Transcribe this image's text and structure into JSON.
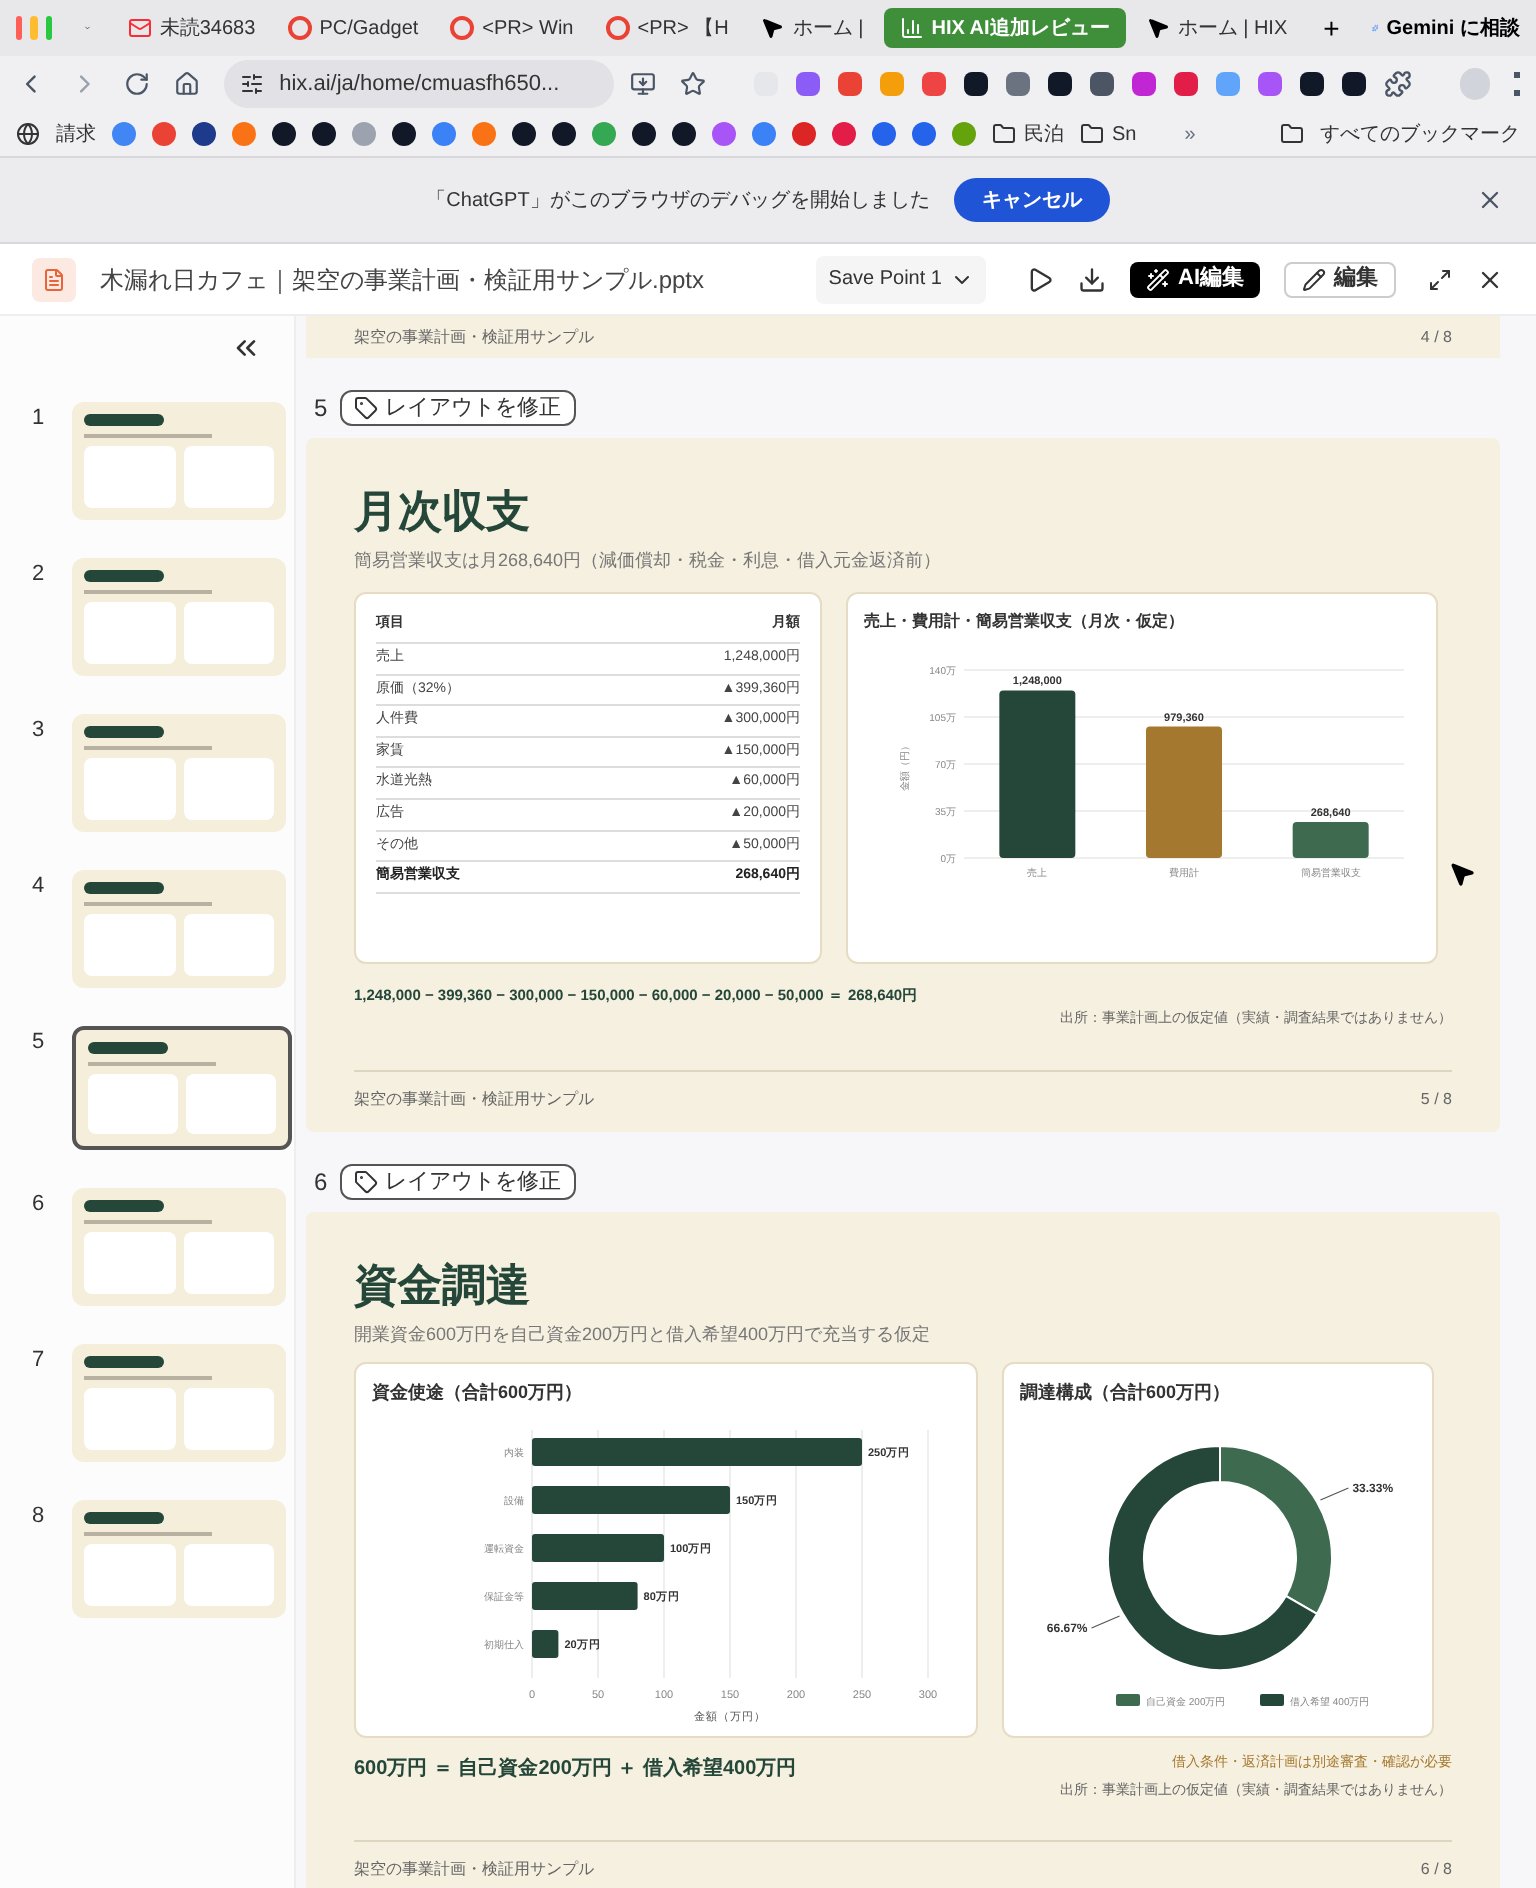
{
  "browser": {
    "tabs": [
      {
        "label": "未読34683",
        "selected": false
      },
      {
        "label": "PC/Gadget",
        "selected": false
      },
      {
        "label": "<PR> Win",
        "selected": false
      },
      {
        "label": "<PR> 【H",
        "selected": false
      },
      {
        "label": "ホーム |",
        "selected": false
      },
      {
        "label": "HIX AI追加レビュー",
        "selected": true
      },
      {
        "label": "ホーム | HIX",
        "selected": false
      }
    ],
    "new_tab": "+",
    "gemini": "Gemini に相談",
    "address": "hix.ai/ja/home/cmuasfh650...",
    "bookmark_first": "請求",
    "folders": [
      "民泊",
      "Sn"
    ],
    "more": "»",
    "all_bookmarks": "すべてのブックマーク"
  },
  "infobar": {
    "message": "「ChatGPT」がこのブラウザのデバッグを開始しました",
    "button": "キャンセル"
  },
  "header": {
    "file_name": "木漏れ日カフェ｜架空の事業計画・検証用サンプル.pptx",
    "save_point": "Save Point 1",
    "ai_edit": "AI編集",
    "edit": "編集"
  },
  "sidebar": {
    "slides": [
      {
        "number": "1",
        "selected": false
      },
      {
        "number": "2",
        "selected": false
      },
      {
        "number": "3",
        "selected": false
      },
      {
        "number": "4",
        "selected": false
      },
      {
        "number": "5",
        "selected": true
      },
      {
        "number": "6",
        "selected": false
      },
      {
        "number": "7",
        "selected": false
      },
      {
        "number": "8",
        "selected": false
      }
    ]
  },
  "slides": [
    {
      "kind": "partial",
      "footer": "架空の事業計画・検証用サンプル",
      "page": "4 / 8"
    },
    {
      "kind": "table_chart",
      "number": "5",
      "fix_button": "レイアウトを修正",
      "title": "月次収支",
      "subtitle": "簡易営業収支は月268,640円（減価償却・税金・利息・借入元金返済前）",
      "table": {
        "columns": [
          "項目",
          "月額"
        ],
        "rows": [
          {
            "item": "売上",
            "amount": "1,248,000円",
            "bold": false
          },
          {
            "item": "原価（32%）",
            "amount": "▲399,360円",
            "bold": false
          },
          {
            "item": "人件費",
            "amount": "▲300,000円",
            "bold": false
          },
          {
            "item": "家賃",
            "amount": "▲150,000円",
            "bold": false
          },
          {
            "item": "水道光熱",
            "amount": "▲60,000円",
            "bold": false
          },
          {
            "item": "広告",
            "amount": "▲20,000円",
            "bold": false
          },
          {
            "item": "その他",
            "amount": "▲50,000円",
            "bold": false
          },
          {
            "item": "簡易営業収支",
            "amount": "268,640円",
            "bold": true
          }
        ]
      },
      "chart_data": {
        "type": "bar",
        "title": "売上・費用計・簡易営業収支（月次・仮定）",
        "ylabel": "金額（円）",
        "categories": [
          "売上",
          "費用計",
          "簡易営業収支"
        ],
        "values": [
          124.8,
          97.9,
          26.9
        ],
        "colors": [
          "#24473a",
          "#a5782f",
          "#3e6b50"
        ],
        "grid": true,
        "ylim": [
          0,
          140
        ],
        "yticks": [
          {
            "value": 0,
            "label": "0万"
          },
          {
            "value": 35,
            "label": "35万"
          },
          {
            "value": 70,
            "label": "70万"
          },
          {
            "value": 105,
            "label": "105万"
          },
          {
            "value": 140,
            "label": "140万"
          }
        ],
        "annotations": [
          {
            "x": "売上",
            "y": 124.8,
            "text": "1,248,000"
          },
          {
            "x": "費用計",
            "y": 97.9,
            "text": "979,360"
          },
          {
            "x": "簡易営業収支",
            "y": 26.9,
            "text": "268,640"
          }
        ]
      },
      "formula": "1,248,000 − 399,360 − 300,000 − 150,000 − 60,000 − 20,000 − 50,000 ＝ 268,640円",
      "source": "出所：事業計画上の仮定値（実績・調査結果ではありません）",
      "footer": "架空の事業計画・検証用サンプル",
      "page": "5 / 8"
    },
    {
      "kind": "funding",
      "number": "6",
      "fix_button": "レイアウトを修正",
      "title": "資金調達",
      "subtitle": "開業資金600万円を自己資金200万円と借入希望400万円で充当する仮定",
      "chart_data": {
        "type": "bar",
        "orientation": "horizontal",
        "title": "資金使途（合計600万円）",
        "xlabel": "金額（万円）",
        "categories": [
          "内装",
          "設備",
          "運転資金",
          "保証金等",
          "初期仕入"
        ],
        "values": [
          250,
          150,
          100,
          80,
          20
        ],
        "colors": [
          "#24473a",
          "#24473a",
          "#24473a",
          "#24473a",
          "#24473a"
        ],
        "grid": true,
        "xlim": [
          0,
          300
        ],
        "xticks": [
          0,
          50,
          100,
          150,
          200,
          250,
          300
        ],
        "value_labels": [
          "250万円",
          "150万円",
          "100万円",
          "80万円",
          "20万円"
        ]
      },
      "donut": {
        "chart_data": {
          "type": "donut",
          "title": "調達構成（合計600万円）",
          "categories": [
            "自己資金 200万円",
            "借入希望 400万円"
          ],
          "values": [
            33.33,
            66.67
          ],
          "colors": [
            "#3e6b50",
            "#24473a"
          ],
          "legend": "bottom",
          "value_labels": [
            "33.33%",
            "66.67%"
          ]
        }
      },
      "formula": "600万円 ＝ 自己資金200万円 ＋ 借入希望400万円",
      "note": "借入条件・返済計画は別途審査・確認が必要",
      "source": "出所：事業計画上の仮定値（実績・調査結果ではありません）",
      "footer": "架空の事業計画・検証用サンプル",
      "page": "6 / 8"
    }
  ]
}
